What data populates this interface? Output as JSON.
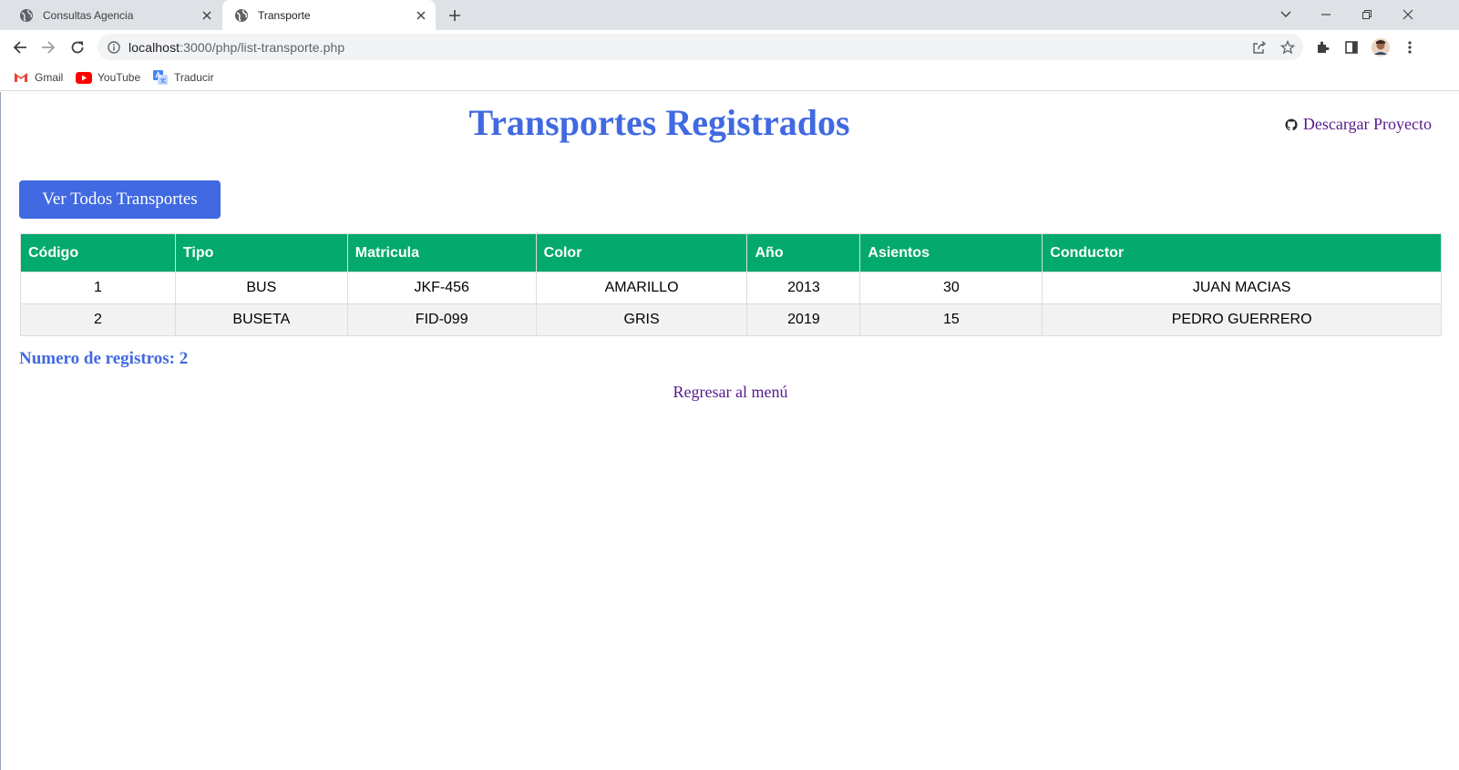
{
  "browser": {
    "tabs": [
      {
        "title": "Consultas Agencia",
        "icon": "globe-icon",
        "active": false
      },
      {
        "title": "Transporte",
        "icon": "globe-icon",
        "active": true
      }
    ],
    "url_host": "localhost",
    "url_rest": ":3000/php/list-transporte.php",
    "bookmarks": [
      {
        "label": "Gmail",
        "icon": "gmail-icon"
      },
      {
        "label": "YouTube",
        "icon": "youtube-icon"
      },
      {
        "label": "Traducir",
        "icon": "translate-icon"
      }
    ]
  },
  "page": {
    "title": "Transportes Registrados",
    "download_label": "Descargar Proyecto",
    "view_all_button": "Ver Todos Transportes",
    "count_label": "Numero de registros: 2",
    "back_link": "Regresar al menú"
  },
  "table": {
    "columns": [
      "Código",
      "Tipo",
      "Matricula",
      "Color",
      "Año",
      "Asientos",
      "Conductor"
    ],
    "rows": [
      [
        "1",
        "BUS",
        "JKF-456",
        "AMARILLO",
        "2013",
        "30",
        "JUAN MACIAS"
      ],
      [
        "2",
        "BUSETA",
        "FID-099",
        "GRIS",
        "2019",
        "15",
        "PEDRO GUERRERO"
      ]
    ]
  },
  "colors": {
    "accent": "#4169e1",
    "table_header": "#04aa6d",
    "link_visited": "#551a8b"
  }
}
